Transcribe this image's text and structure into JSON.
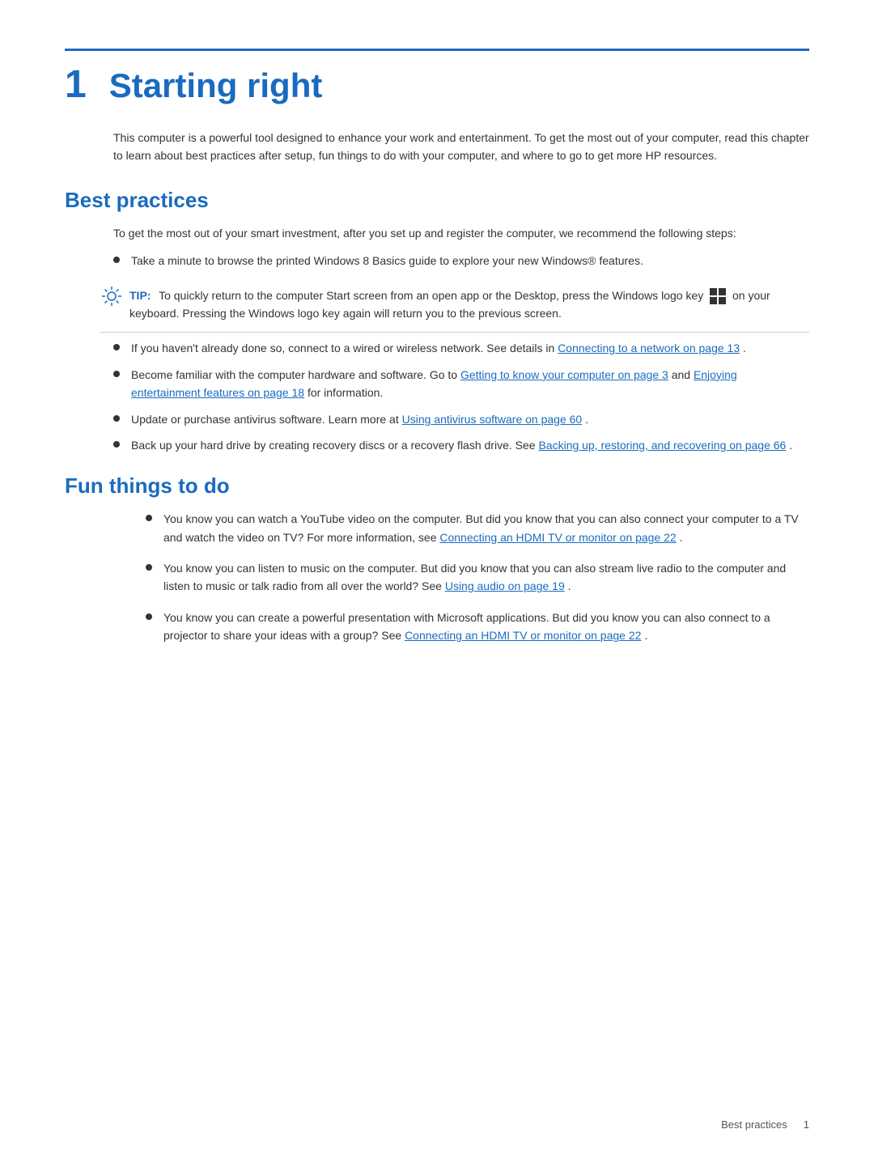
{
  "chapter": {
    "number": "1",
    "title": "Starting right"
  },
  "intro": "This computer is a powerful tool designed to enhance your work and entertainment. To get the most out of your computer, read this chapter to learn about best practices after setup, fun things to do with your computer, and where to go to get more HP resources.",
  "best_practices": {
    "title": "Best practices",
    "intro": "To get the most out of your smart investment, after you set up and register the computer, we recommend the following steps:",
    "bullet1": "Take a minute to browse the printed Windows 8 Basics guide to explore your new Windows® features.",
    "tip_label": "TIP:",
    "tip_text": "To quickly return to the computer Start screen from an open app or the Desktop, press the Windows logo key",
    "tip_text2": "on your keyboard. Pressing the Windows logo key again will return you to the previous screen.",
    "bullet2_before": "If you haven't already done so, connect to a wired or wireless network. See details in",
    "bullet2_link": "Connecting to a network on page 13",
    "bullet2_after": ".",
    "bullet3_before": "Become familiar with the computer hardware and software. Go to",
    "bullet3_link1": "Getting to know your computer on page 3",
    "bullet3_mid": "and",
    "bullet3_link2": "Enjoying entertainment features on page 18",
    "bullet3_after": "for information.",
    "bullet4_before": "Update or purchase antivirus software. Learn more at",
    "bullet4_link": "Using antivirus software on page 60",
    "bullet4_after": ".",
    "bullet5_before": "Back up your hard drive by creating recovery discs or a recovery flash drive. See",
    "bullet5_link": "Backing up, restoring, and recovering on page 66",
    "bullet5_after": "."
  },
  "fun_things": {
    "title": "Fun things to do",
    "item1_before": "You know you can watch a YouTube video on the computer. But did you know that you can also connect your computer to a TV and watch the video on TV? For more information, see",
    "item1_link": "Connecting an HDMI TV or monitor on page 22",
    "item1_after": ".",
    "item2_before": "You know you can listen to music on the computer. But did you know that you can also stream live radio to the computer and listen to music or talk radio from all over the world? See",
    "item2_link": "Using audio on page 19",
    "item2_after": ".",
    "item3_before": "You know you can create a powerful presentation with Microsoft applications. But did you know you can also connect to a projector to share your ideas with a group? See",
    "item3_link": "Connecting an HDMI TV or monitor on page 22",
    "item3_after": "."
  },
  "footer": {
    "text": "Best practices",
    "page": "1"
  }
}
